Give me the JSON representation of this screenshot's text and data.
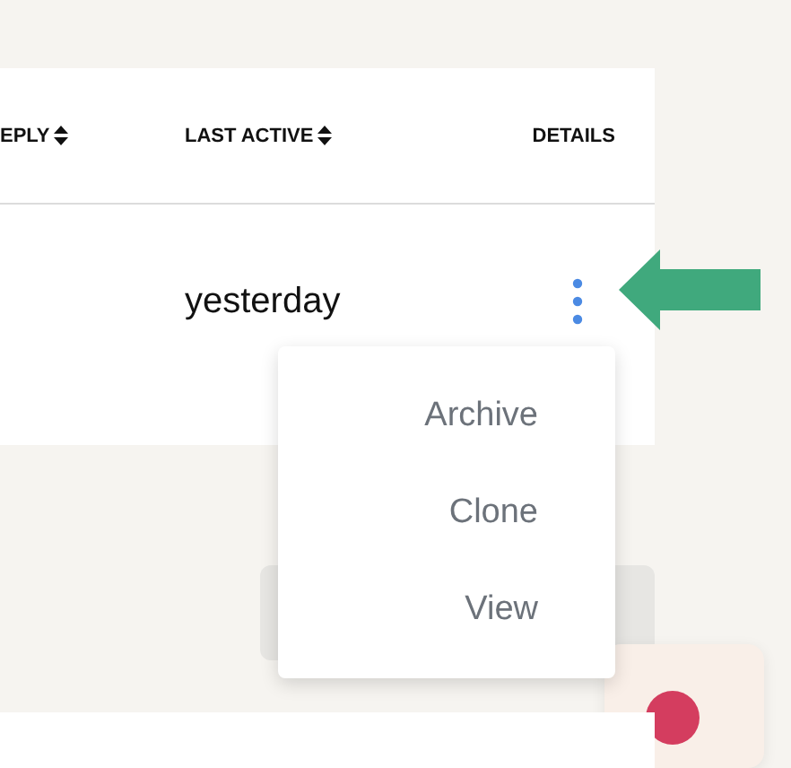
{
  "table": {
    "columns": [
      {
        "label": "EPLY",
        "sortable": true
      },
      {
        "label": "LAST ACTIVE",
        "sortable": true
      },
      {
        "label": "DETAILS",
        "sortable": false
      }
    ],
    "rows": [
      {
        "last_active": "yesterday"
      }
    ]
  },
  "menu": {
    "items": [
      "Archive",
      "Clone",
      "View"
    ]
  }
}
